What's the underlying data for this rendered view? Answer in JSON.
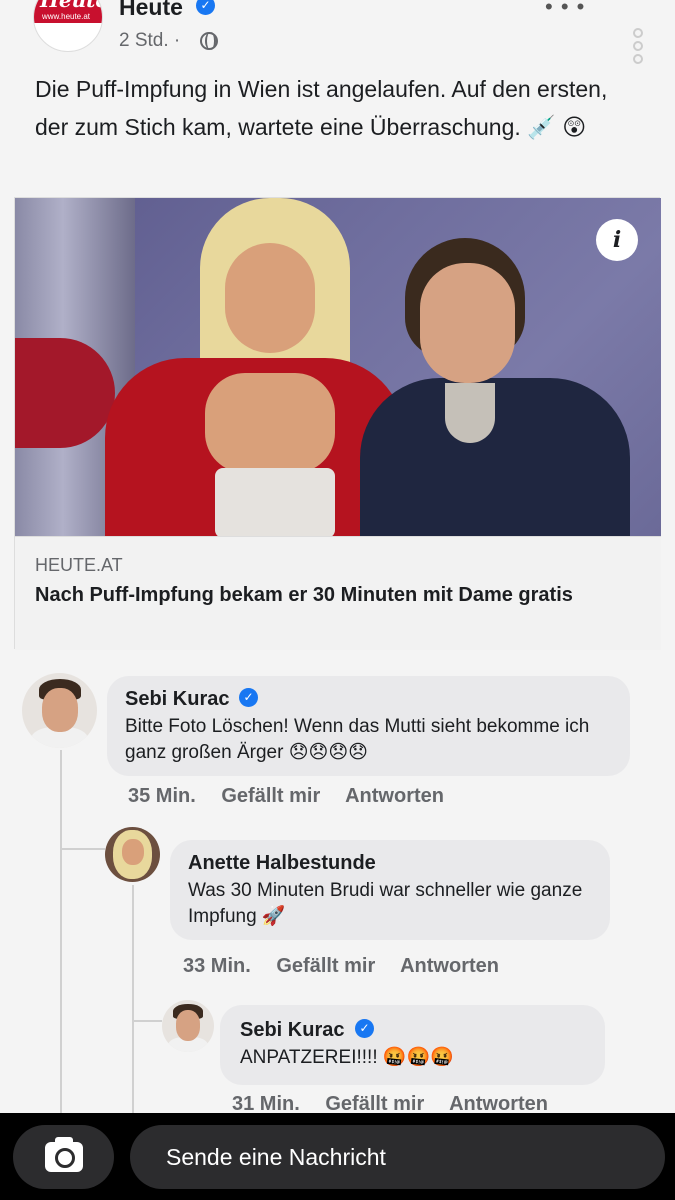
{
  "header": {
    "logo_text": "Heute",
    "logo_url": "www.heute.at",
    "page_name": "Heute",
    "post_time": "2 Std. ·",
    "verified": "✓"
  },
  "post": {
    "text": "Die Puff-Impfung in Wien ist angelaufen. Auf den ersten, der zum Stich kam, wartete eine Überraschung. 💉 😲"
  },
  "link_card": {
    "info_icon": "i",
    "domain": "HEUTE.AT",
    "headline": "Nach Puff-Impfung bekam er 30 Minuten mit Dame gratis"
  },
  "comments": [
    {
      "author": "Sebi Kurac",
      "verified": "✓",
      "text": "Bitte Foto Löschen! Wenn das Mutti sieht bekomme ich ganz großen Ärger 😞😞😞😞",
      "time": "35 Min.",
      "like": "Gefällt mir",
      "reply": "Antworten"
    },
    {
      "author": "Anette Halbestunde",
      "text": "Was 30 Minuten Brudi war schneller wie ganze Impfung 🚀",
      "time": "33 Min.",
      "like": "Gefällt mir",
      "reply": "Antworten"
    },
    {
      "author": "Sebi Kurac",
      "verified": "✓",
      "text": "ANPATZEREI!!!! 🤬🤬🤬",
      "time": "31 Min.",
      "like": "Gefällt mir",
      "reply": "Antworten"
    }
  ],
  "bottom_bar": {
    "placeholder": "Sende eine Nachricht"
  },
  "colors": {
    "brand_red": "#c8102e",
    "verified_blue": "#1877f2",
    "bottom_bar": "#000000"
  }
}
